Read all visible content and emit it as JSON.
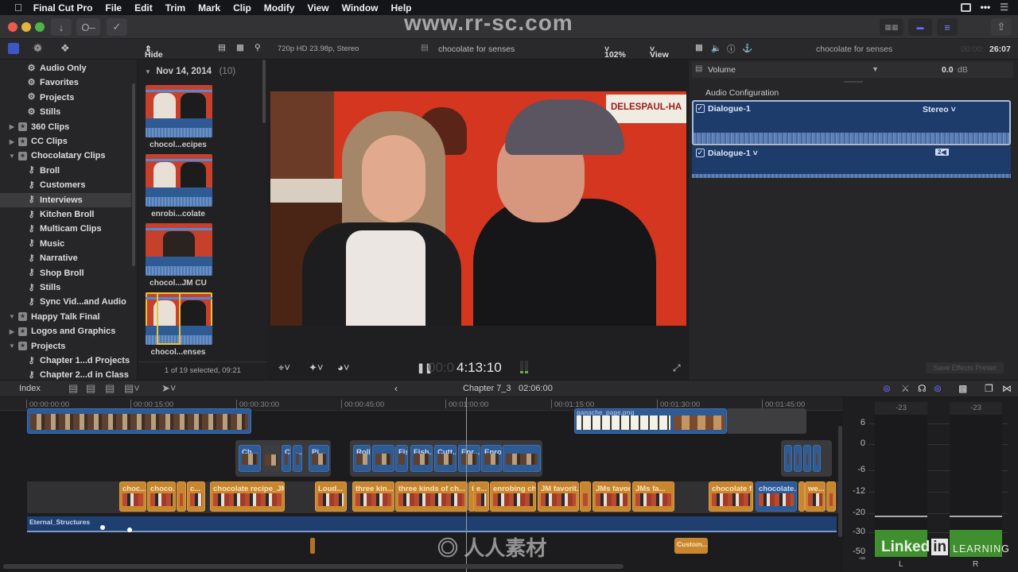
{
  "menubar": {
    "app": "Final Cut Pro",
    "items": [
      "File",
      "Edit",
      "Trim",
      "Mark",
      "Clip",
      "Modify",
      "View",
      "Window",
      "Help"
    ]
  },
  "watermark": "www.rr-sc.com",
  "toolbar": {
    "filter": "Hide Rejected",
    "format": "720p HD 23.98p, Stereo",
    "viewer_title": "chocolate for senses",
    "zoom": "102%",
    "view": "View",
    "inspector_title": "chocolate for senses",
    "inspector_timecode_dim": "00:00:",
    "inspector_timecode": "26:07"
  },
  "sidebar": {
    "items": [
      {
        "label": "Audio Only",
        "icon": "gear",
        "indent": 1
      },
      {
        "label": "Favorites",
        "icon": "gear",
        "indent": 1
      },
      {
        "label": "Projects",
        "icon": "gear",
        "indent": 1
      },
      {
        "label": "Stills",
        "icon": "gear",
        "indent": 1
      },
      {
        "label": "360 Clips",
        "icon": "event",
        "indent": 0,
        "disclosure": "collapsed"
      },
      {
        "label": "CC Clips",
        "icon": "event",
        "indent": 0,
        "disclosure": "collapsed"
      },
      {
        "label": "Chocolatary Clips",
        "icon": "event",
        "indent": 0,
        "disclosure": "expanded"
      },
      {
        "label": "Broll",
        "icon": "key",
        "indent": 1
      },
      {
        "label": "Customers",
        "icon": "key",
        "indent": 1
      },
      {
        "label": "Interviews",
        "icon": "key",
        "indent": 1,
        "selected": true
      },
      {
        "label": "Kitchen Broll",
        "icon": "key",
        "indent": 1
      },
      {
        "label": "Multicam Clips",
        "icon": "key",
        "indent": 1
      },
      {
        "label": "Music",
        "icon": "key",
        "indent": 1
      },
      {
        "label": "Narrative",
        "icon": "key",
        "indent": 1
      },
      {
        "label": "Shop Broll",
        "icon": "key",
        "indent": 1
      },
      {
        "label": "Stills",
        "icon": "key",
        "indent": 1
      },
      {
        "label": "Sync Vid...and Audio",
        "icon": "key",
        "indent": 1
      },
      {
        "label": "Happy Talk Final",
        "icon": "event",
        "indent": 0,
        "disclosure": "expanded"
      },
      {
        "label": "Logos and Graphics",
        "icon": "event",
        "indent": 0,
        "disclosure": "collapsed"
      },
      {
        "label": "Projects",
        "icon": "event",
        "indent": 0,
        "disclosure": "expanded"
      },
      {
        "label": "Chapter 1...d Projects",
        "icon": "key",
        "indent": 1
      },
      {
        "label": "Chapter 2...d in Class",
        "icon": "key",
        "indent": 1
      }
    ]
  },
  "browser": {
    "group_date": "Nov 14, 2014",
    "group_count": "(10)",
    "clips": [
      "chocol...ecipes",
      "enrobi...colate",
      "chocol...JM CU",
      "chocol...enses"
    ],
    "status": "1 of 19 selected, 09:21"
  },
  "viewer": {
    "sign_text": "DELESPAUL-HA",
    "timecode_dim": "00:0",
    "timecode": "4:13:10"
  },
  "inspector": {
    "volume_label": "Volume",
    "volume_value": "0.0",
    "volume_unit": "dB",
    "section": "Audio Configuration",
    "channels": [
      {
        "name": "Dialogue-1",
        "config": "Stereo",
        "checked": true,
        "selected": true
      },
      {
        "name": "Dialogue-1",
        "config": "2",
        "checked": true,
        "selected": false
      }
    ],
    "save_preset": "Save Effects Preset"
  },
  "timeline_bar": {
    "index": "Index",
    "project": "Chapter 7_3",
    "duration": "02:06:00"
  },
  "ruler": [
    "00:00:00:00",
    "00:00:15:00",
    "00:00:30:00",
    "00:00:45:00",
    "00:01:00:00",
    "00:01:15:00",
    "00:01:30:00",
    "00:01:45:00"
  ],
  "connected_clips": [
    "Ch...",
    "",
    "C",
    "...",
    "Pi...",
    "Rolli...",
    "",
    "Fis...",
    "Fish...",
    "Cutt...",
    "Enr...",
    "Enrobing...",
    "",
    "",
    "",
    "",
    ""
  ],
  "primary_clips": [
    "choc...",
    "choco...",
    "",
    "c...",
    "chocolate recipe_JM...",
    "Loud...",
    "three kin...",
    "three kinds of ch...",
    "th",
    "e...",
    "enrobing ch...",
    "JM favorit...",
    "",
    "JMs favor...",
    "JMs fa...",
    "chocolate f...",
    "chocolate...",
    "",
    "we...",
    ""
  ],
  "top_clip": "ganache_page.png",
  "music_clip": "Eternal_Structures",
  "title_clip": "Custom...",
  "meters": {
    "peaks": [
      "-23",
      "-23"
    ],
    "scale": [
      "6",
      "0",
      "-6",
      "-12",
      "-20",
      "-30",
      "-50",
      "-∞"
    ],
    "channels": [
      "L",
      "R"
    ]
  },
  "logo": {
    "brand": "Linked",
    "mark": "in",
    "tag": "LEARNING"
  }
}
